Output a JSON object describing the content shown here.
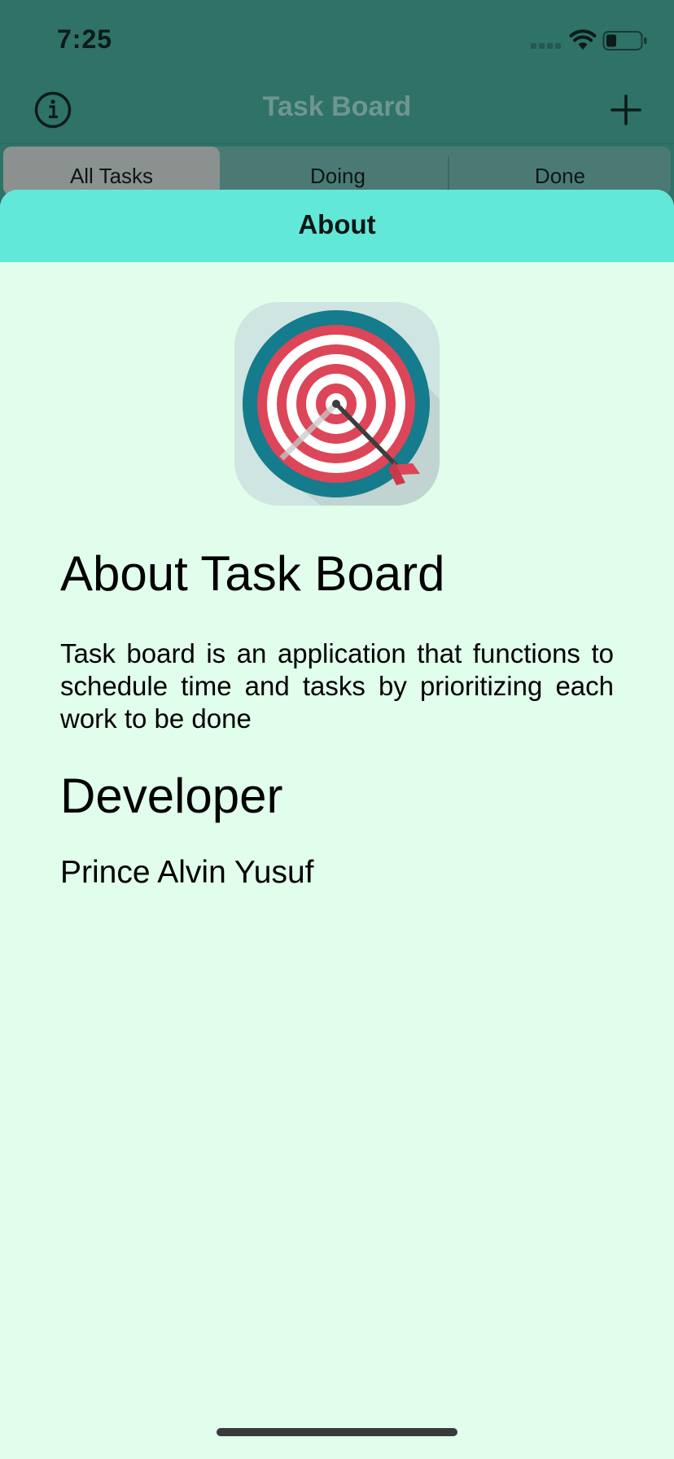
{
  "status_bar": {
    "time": "7:25",
    "icons": [
      "cellular-signal-icon",
      "wifi-icon",
      "battery-icon"
    ]
  },
  "nav": {
    "title": "Task Board",
    "left_icon": "info-icon",
    "right_icon": "plus-icon"
  },
  "tabs": [
    {
      "label": "All Tasks",
      "selected": true
    },
    {
      "label": "Doing",
      "selected": false
    },
    {
      "label": "Done",
      "selected": false
    }
  ],
  "sheet": {
    "title": "About",
    "app_icon": "target-with-arrow-icon",
    "about_heading": "About Task Board",
    "about_text": "Task board is an application that functions to schedule time and tasks by prioritizing each work to be done",
    "developer_heading": "Developer",
    "developer_name": "Prince Alvin Yusuf"
  },
  "colors": {
    "background_dimmed": "#2e7268",
    "sheet_header": "#62e8d9",
    "sheet_background": "#e1fdec",
    "target_teal": "#147c8c",
    "target_red": "#dc4658"
  }
}
